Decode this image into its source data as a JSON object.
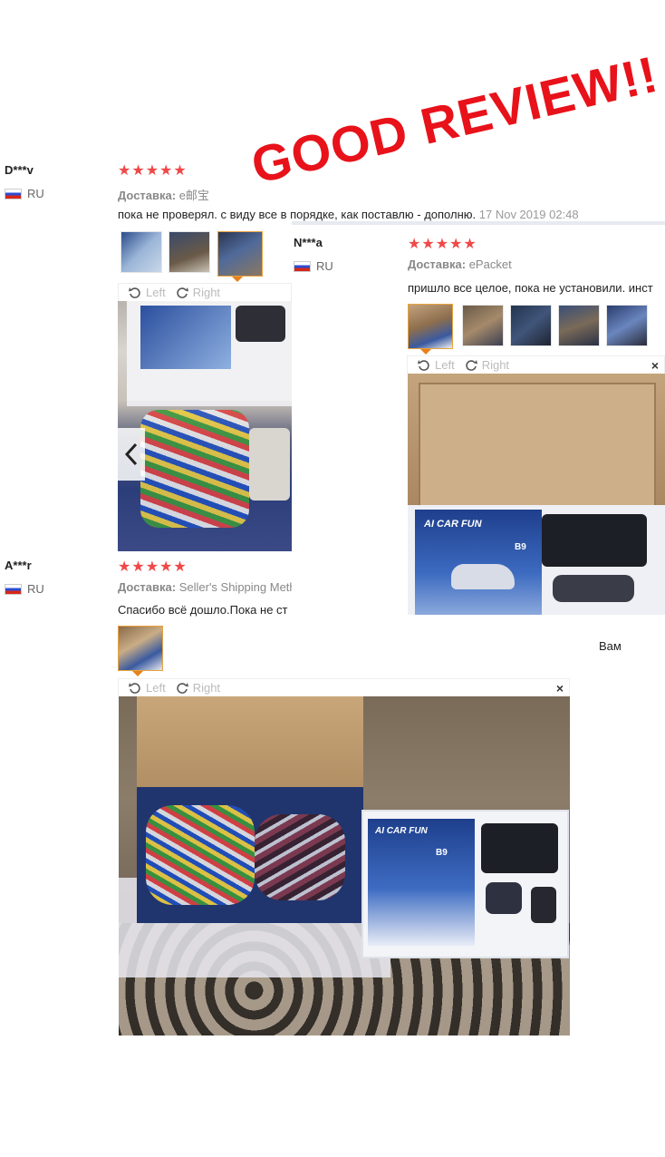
{
  "overlay": {
    "text": "GOOD REVIEW!!"
  },
  "reviews": [
    {
      "user": "D***v",
      "country": "RU",
      "stars": "★★★★★",
      "shipping_label": "Доставка:",
      "shipping_value": "e邮宝",
      "text": "пока не проверял. с виду все в порядке, как поставлю - дополню.",
      "date": "17 Nov 2019 02:48",
      "rotate_left": "Left",
      "rotate_right": "Right"
    },
    {
      "user": "N***a",
      "country": "RU",
      "stars": "★★★★★",
      "shipping_label": "Доставка:",
      "shipping_value": "ePacket",
      "text": "пришло все целое, пока не установили. инст",
      "rotate_left": "Left",
      "rotate_right": "Right",
      "close": "×"
    },
    {
      "user": "A***r",
      "country": "RU",
      "stars": "★★★★★",
      "shipping_label": "Доставка:",
      "shipping_value": "Seller's Shipping Meth",
      "text": "Спасибо всё дошло.Пока не ст",
      "side_text": "Вам",
      "rotate_left": "Left",
      "rotate_right": "Right",
      "close": "×"
    }
  ],
  "photo_labels": {
    "brand": "AI CAR FUN",
    "model": "B9"
  },
  "colors": {
    "star": "#f04848",
    "accent": "#e8801e",
    "overlay": "#e8121a"
  }
}
